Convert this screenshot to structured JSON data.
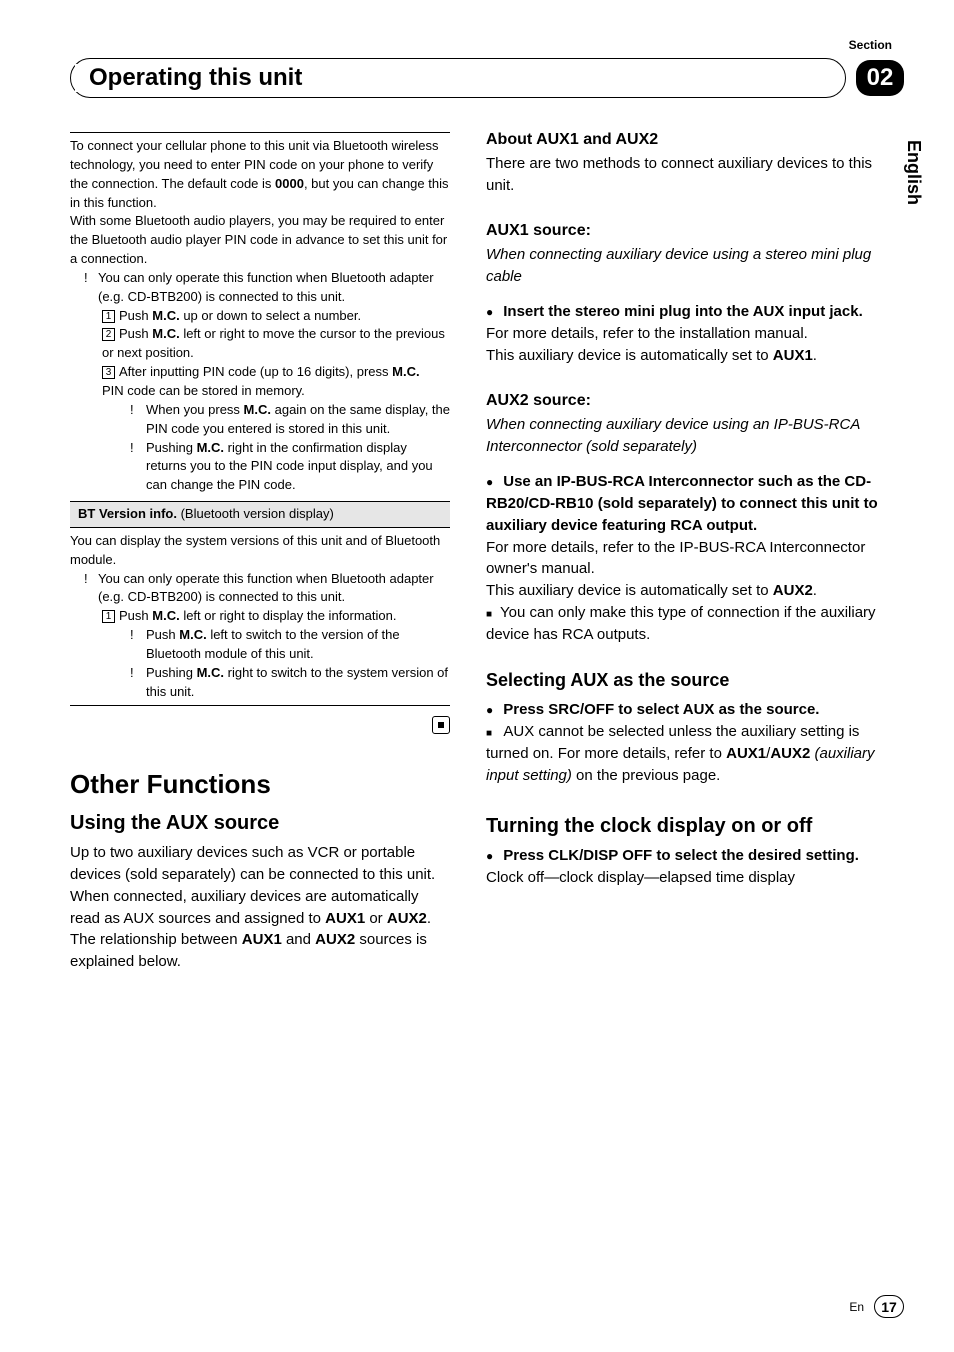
{
  "header": {
    "section_label": "Section",
    "section_number": "02",
    "title": "Operating this unit",
    "side_tab": "English"
  },
  "left": {
    "rule_intro": "To connect your cellular phone to this unit via Bluetooth wireless technology, you need to enter PIN code on your phone to verify the connection. The default code is ",
    "rule_intro_bold": "0000",
    "rule_intro_end": ", but you can change this in this function.",
    "p2": "With some Bluetooth audio players, you may be required to enter the Bluetooth audio player PIN code in advance to set this unit for a connection.",
    "b1": "You can only operate this function when Bluetooth adapter (e.g. CD-BTB200) is connected to this unit.",
    "s1_pre": "Push ",
    "s1_b": "M.C.",
    "s1_post": " up or down to select a number.",
    "s2_pre": "Push ",
    "s2_b": "M.C.",
    "s2_post": " left or right to move the cursor to the previous or next position.",
    "s3_pre": "After inputting PIN code (up to 16 digits), press ",
    "s3_b": "M.C.",
    "s3_sub": "PIN code can be stored in memory.",
    "s3_li1_pre": "When you press ",
    "s3_li1_b": "M.C.",
    "s3_li1_post": " again on the same display, the PIN code you entered is stored in this unit.",
    "s3_li2_pre": "Pushing ",
    "s3_li2_b": "M.C.",
    "s3_li2_post": " right in the confirmation display returns you to the PIN code input display, and you can change the PIN code.",
    "shaded_b": "BT Version info.",
    "shaded_rest": " (Bluetooth version display)",
    "p3": "You can display the system versions of this unit and of Bluetooth module.",
    "b2": "You can only operate this function when Bluetooth adapter (e.g. CD-BTB200) is connected to this unit.",
    "t1_pre": "Push ",
    "t1_b": "M.C.",
    "t1_post": " left or right to display the information.",
    "t1_li1_pre": "Push ",
    "t1_li1_b": "M.C.",
    "t1_li1_post": " left to switch to the version of the Bluetooth module of this unit.",
    "t1_li2_pre": "Pushing ",
    "t1_li2_b": "M.C.",
    "t1_li2_post": " right to switch to the system version of this unit.",
    "h2": "Other Functions",
    "h3": "Using the AUX source",
    "paux_pre": "Up to two auxiliary devices such as VCR or portable devices (sold separately) can be connected to this unit. When connected, auxiliary devices are automatically read as AUX sources and assigned to ",
    "paux_b1": "AUX1",
    "paux_mid1": " or ",
    "paux_b2": "AUX2",
    "paux_mid2": ". The relationship between ",
    "paux_b3": "AUX1",
    "paux_mid3": " and ",
    "paux_b4": "AUX2",
    "paux_end": " sources is explained below."
  },
  "right": {
    "h_about_pre": "About ",
    "h_about_b1": "AUX1 and AUX2",
    "p_about": "There are two methods to connect auxiliary de­vices to this unit.",
    "h_aux1_b": "AUX1",
    "h_aux1_post": " source:",
    "aux1_it": "When connecting auxiliary device using a stereo mini plug cable",
    "aux1_step": "Insert the stereo mini plug into the AUX input jack.",
    "aux1_p1": "For more details, refer to the installation man­ual.",
    "aux1_p2_pre": "This auxiliary device is automatically set to ",
    "aux1_p2_b": "AUX1",
    "aux1_p2_end": ".",
    "h_aux2_b": "AUX2",
    "h_aux2_post": " source:",
    "aux2_it": "When connecting auxiliary device using an IP-BUS-RCA Interconnector (sold separately)",
    "aux2_step": "Use an IP-BUS-RCA Interconnector such as the CD-RB20/CD-RB10 (sold separately) to connect this unit to auxiliary device fea­turing RCA output.",
    "aux2_p1": "For more details, refer to the IP-BUS-RCA Inter­connector owner's manual.",
    "aux2_p2_pre": "This auxiliary device is automatically set to ",
    "aux2_p2_b": "AUX2",
    "aux2_p2_end": ".",
    "aux2_note": "You can only make this type of connection if the auxiliary device has RCA outputs.",
    "h_sel": "Selecting AUX as the source",
    "sel_step": "Press SRC/OFF to select AUX as the source.",
    "sel_note_pre": "AUX cannot be selected unless the auxiliary setting is turned on. For more details, refer to ",
    "sel_note_b": "AUX1",
    "sel_note_slash": "/",
    "sel_note_b2": "AUX2",
    "sel_note_it": " (auxiliary input setting)",
    "sel_note_end": " on the pre­vious page.",
    "h_clock": "Turning the clock display on or off",
    "clock_step": "Press CLK/DISP OFF to select the desired setting.",
    "clock_p": "Clock off—clock display—elapsed time dis­play"
  },
  "footer": {
    "lang": "En",
    "page": "17"
  }
}
